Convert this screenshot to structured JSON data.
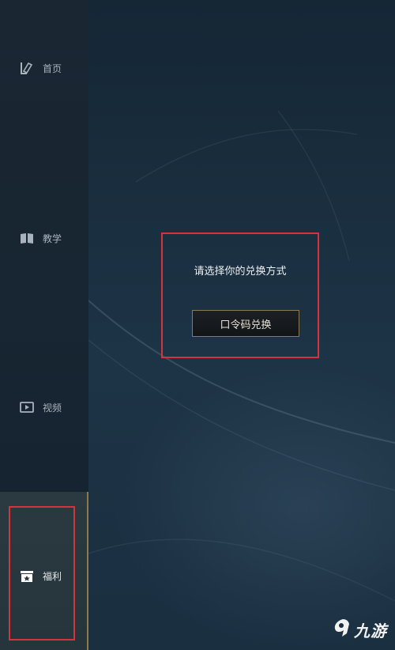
{
  "sidebar": {
    "items": [
      {
        "label": "首页",
        "icon": "home-book-icon"
      },
      {
        "label": "教学",
        "icon": "book-icon"
      },
      {
        "label": "视频",
        "icon": "video-play-icon"
      },
      {
        "label": "福利",
        "icon": "gift-box-icon",
        "selected": true
      }
    ]
  },
  "dialog": {
    "title": "请选择你的兑换方式",
    "redeem_button": "口令码兑换"
  },
  "watermark": {
    "text": "九游",
    "icon": "jiuyou-logo-icon"
  },
  "colors": {
    "highlight_border": "#d5343d",
    "accent_gold": "#8d7a4c",
    "background": "#1a2f40"
  }
}
